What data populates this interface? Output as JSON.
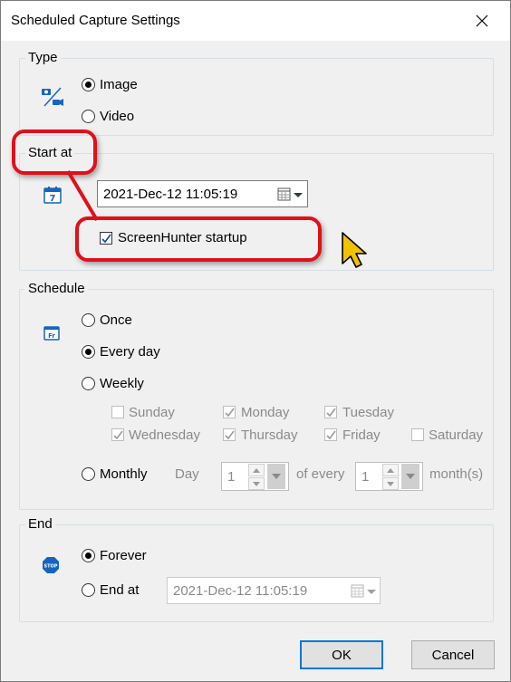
{
  "window": {
    "title": "Scheduled Capture Settings"
  },
  "type_group": {
    "label": "Type",
    "options": [
      {
        "label": "Image",
        "checked": true
      },
      {
        "label": "Video",
        "checked": false
      }
    ]
  },
  "start_group": {
    "label": "Start at",
    "datetime": "2021-Dec-12 11:05:19",
    "startup_label": "ScreenHunter startup",
    "startup_checked": true
  },
  "schedule_group": {
    "label": "Schedule",
    "once": "Once",
    "every_day": "Every day",
    "weekly": "Weekly",
    "days": [
      {
        "label": "Sunday",
        "checked": false
      },
      {
        "label": "Monday",
        "checked": true
      },
      {
        "label": "Tuesday",
        "checked": true
      },
      {
        "label": "Wednesday",
        "checked": true
      },
      {
        "label": "Thursday",
        "checked": true
      },
      {
        "label": "Friday",
        "checked": true
      },
      {
        "label": "Saturday",
        "checked": false
      }
    ],
    "monthly": "Monthly",
    "day_label": "Day",
    "day_value": "1",
    "of_every_label": "of every",
    "month_value": "1",
    "months_label": "month(s)",
    "selected": "every_day"
  },
  "end_group": {
    "label": "End",
    "forever": "Forever",
    "end_at": "End at",
    "end_datetime": "2021-Dec-12 11:05:19",
    "selected": "forever"
  },
  "buttons": {
    "ok": "OK",
    "cancel": "Cancel"
  },
  "colors": {
    "callout": "#e0101b",
    "accent": "#0078d7",
    "cursor": "#f2c100"
  }
}
